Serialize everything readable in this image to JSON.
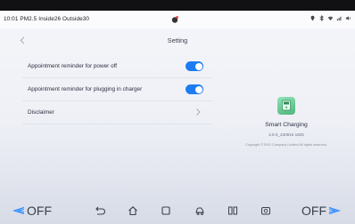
{
  "status_bar": {
    "left_text": "10:01 PM2.5 Inside26 Outside30",
    "icons": [
      "location-icon",
      "bluetooth-icon",
      "wifi-icon",
      "signal-icon",
      "volume-icon"
    ]
  },
  "header": {
    "back_icon": "chevron-left-icon",
    "title": "Setting"
  },
  "settings": {
    "items": [
      {
        "label": "Appointment reminder for power off",
        "control": "toggle",
        "on": true
      },
      {
        "label": "Appointment reminder for plugging in charger",
        "control": "toggle",
        "on": true
      },
      {
        "label": "Disclaimer",
        "control": "chevron"
      }
    ]
  },
  "app_info": {
    "name": "Smart Charging",
    "version": "2.9.0_230916 1825",
    "copyright": "Copyright © BYD Company Limited All rights reserved."
  },
  "dock": {
    "left_climate": "OFF",
    "right_climate": "OFF",
    "icons": [
      "back-icon",
      "home-icon",
      "recents-icon",
      "car-icon",
      "split-screen-icon",
      "camera-icon"
    ]
  },
  "colors": {
    "toggle_on": "#1e7cf2",
    "accent_arrow": "#2f8cff"
  }
}
